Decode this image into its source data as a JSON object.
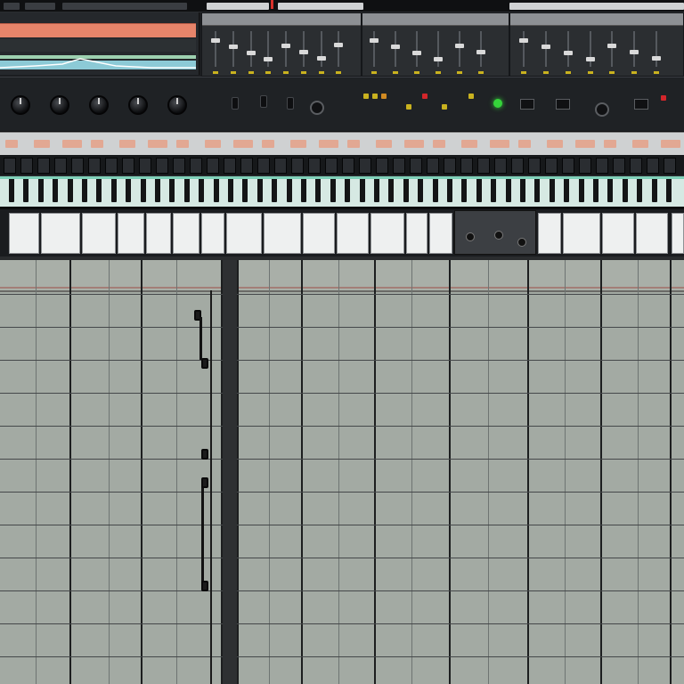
{
  "app": {
    "view": "arrangement",
    "accent_colors": {
      "playhead": "#d8312b",
      "keyboard_accent": "#7fd0b8",
      "led_yellow": "#c9b21f",
      "led_green": "#35d43a",
      "led_red": "#d3262b",
      "grid_bg": "#a3aaa3"
    }
  },
  "top_bar": {
    "segments": 6
  },
  "overview": {
    "bands": [
      "#e6846a",
      "#9dd0b0",
      "#8ccad6"
    ]
  },
  "device_panels": [
    {
      "id": "panel-a",
      "title": "",
      "faders": 8
    },
    {
      "id": "panel-b",
      "title": "",
      "faders": 6
    },
    {
      "id": "panel-c",
      "title": "",
      "faders": 7
    }
  ],
  "rack": {
    "knobs": 5,
    "leds": [
      "yellow",
      "yellow",
      "yellow",
      "orange",
      "red",
      "yellow",
      "green",
      "red"
    ],
    "power_led": "green"
  },
  "label_strip": {
    "center_label": ""
  },
  "sequencer": {
    "steps": 40
  },
  "keyboard": {
    "octaves": 7,
    "black_keys": 46
  },
  "mini_device": {
    "title": ""
  },
  "arrangement": {
    "columns": 14,
    "rows": 12,
    "automation_nodes": 4
  }
}
